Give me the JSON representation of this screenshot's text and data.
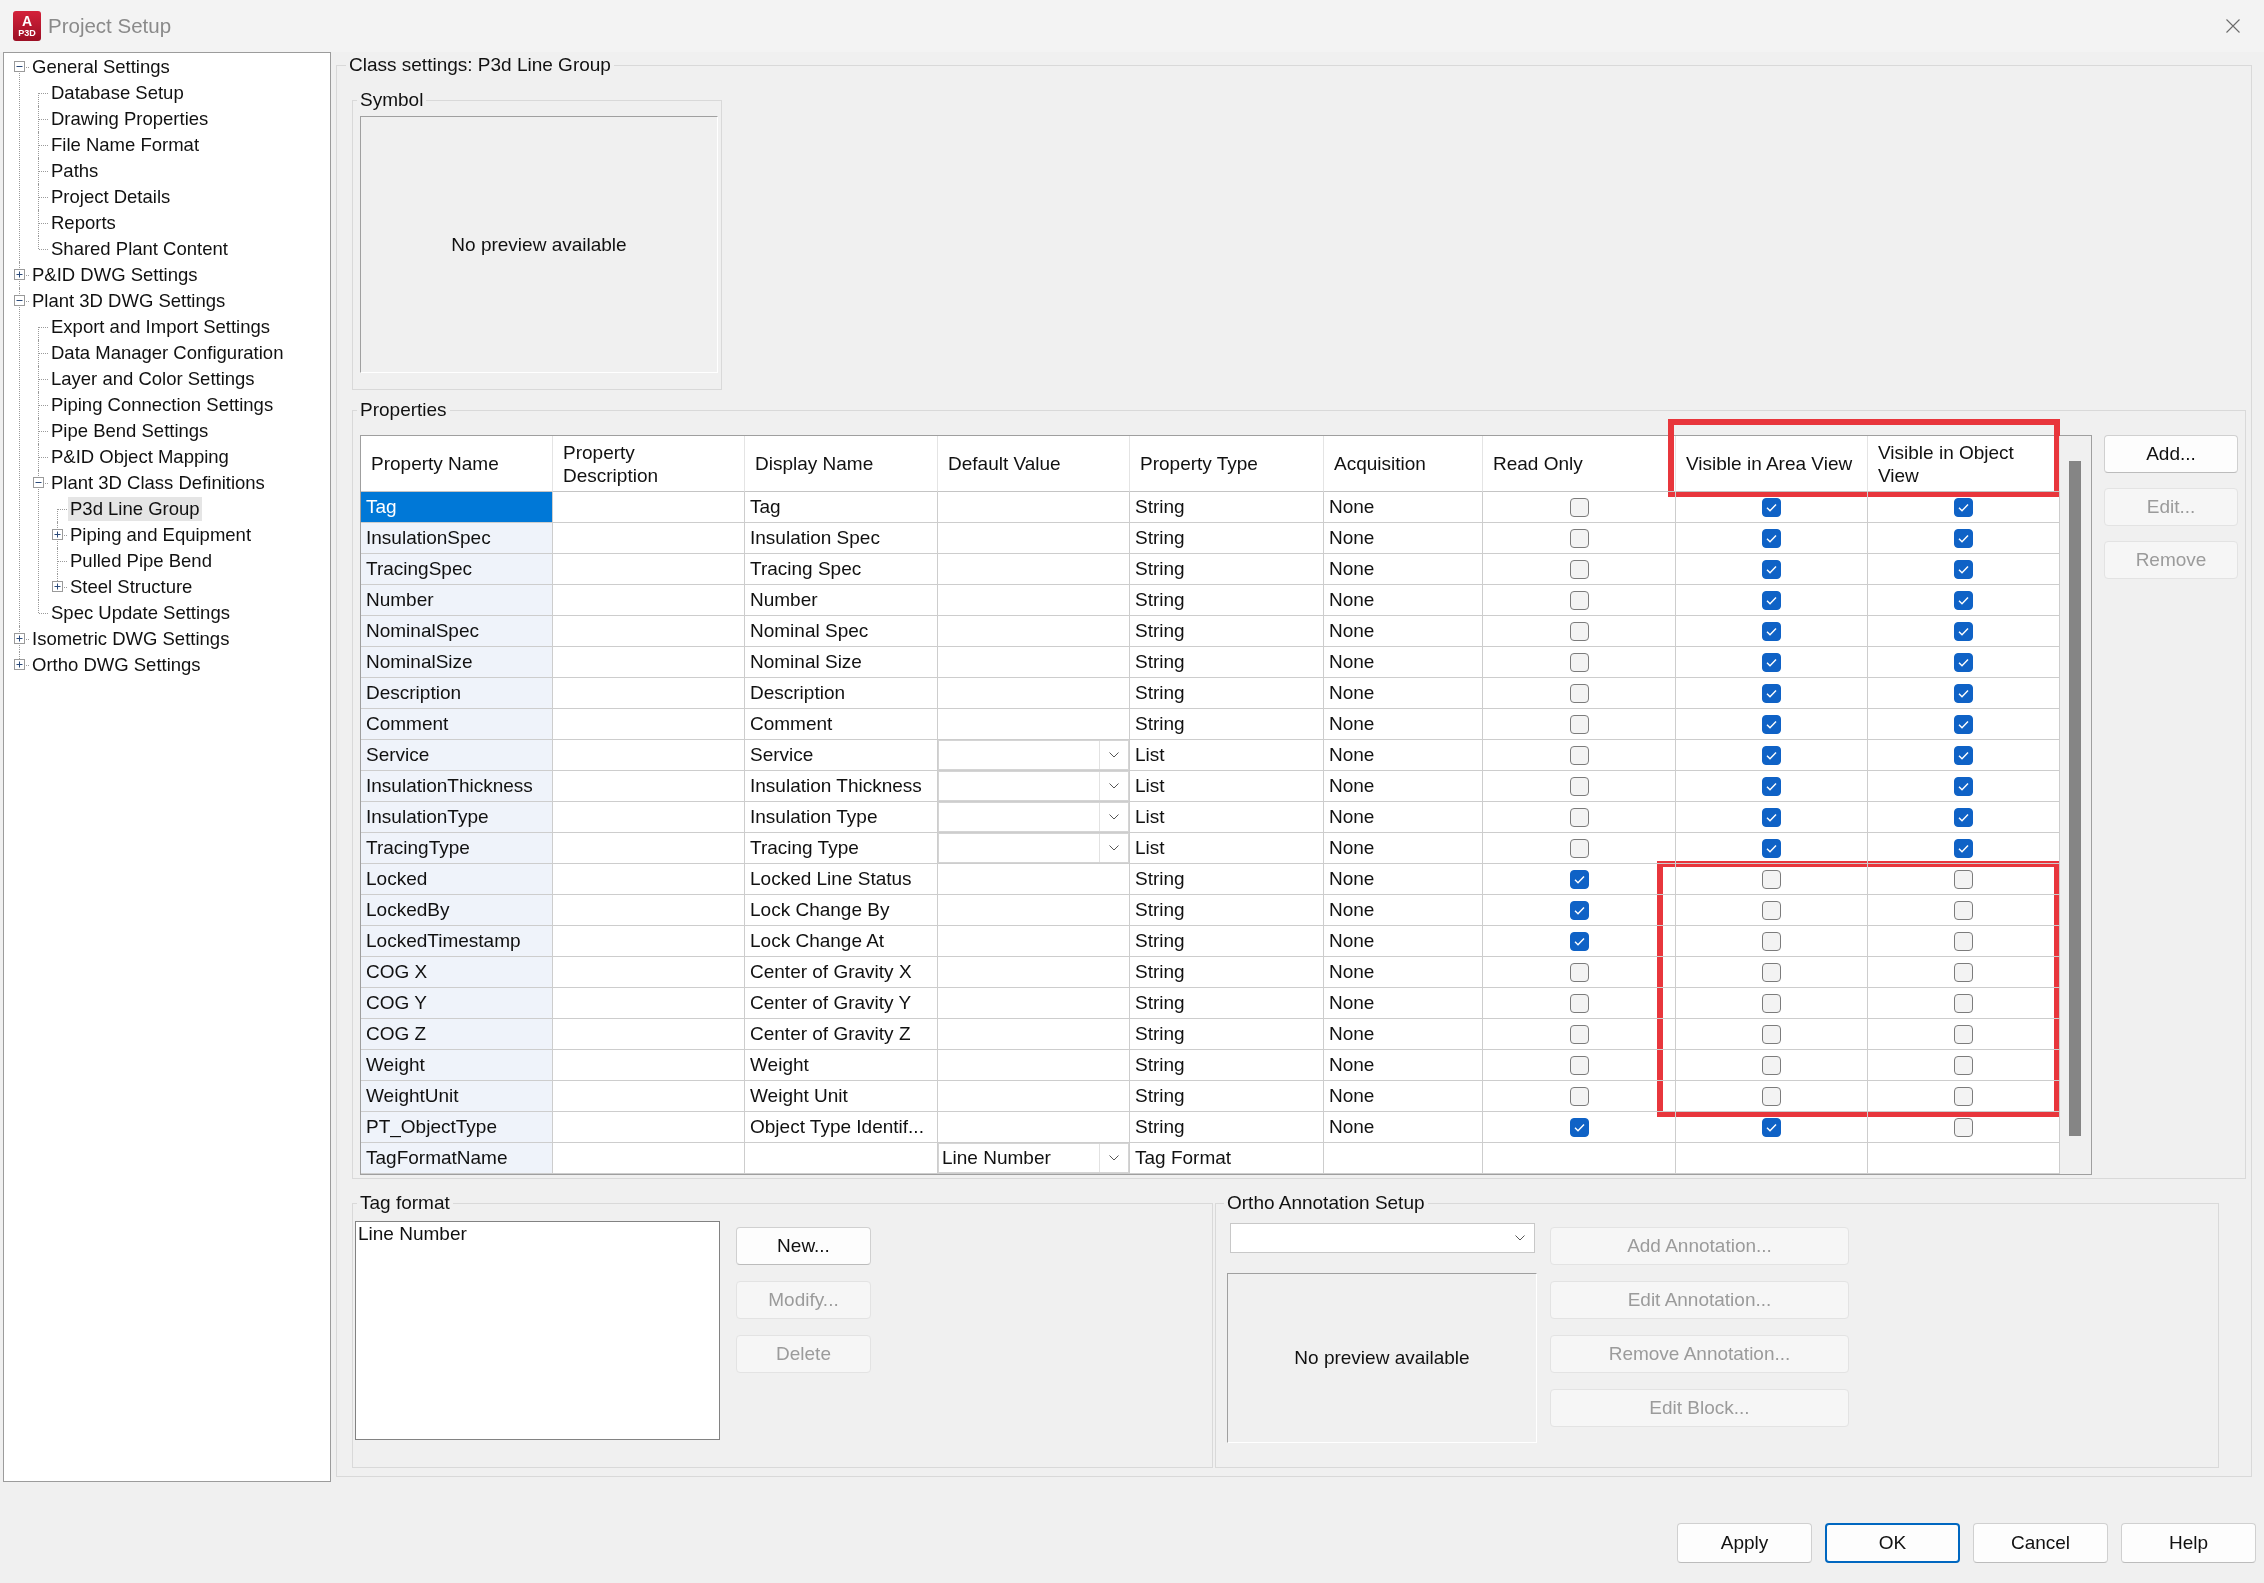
{
  "window": {
    "title": "Project Setup",
    "app_icon": {
      "letter": "A",
      "caption": "P3D"
    }
  },
  "tree": [
    {
      "label": "General Settings",
      "selected": false,
      "expanded": true,
      "children": [
        {
          "label": "Database Setup",
          "selected": false
        },
        {
          "label": "Drawing Properties",
          "selected": false
        },
        {
          "label": "File Name Format",
          "selected": false
        },
        {
          "label": "Paths",
          "selected": false
        },
        {
          "label": "Project Details",
          "selected": false
        },
        {
          "label": "Reports",
          "selected": false
        },
        {
          "label": "Shared Plant Content",
          "selected": false
        }
      ]
    },
    {
      "label": "P&ID DWG Settings",
      "selected": false,
      "expanded": false
    },
    {
      "label": "Plant 3D DWG Settings",
      "selected": false,
      "expanded": true,
      "children": [
        {
          "label": "Export and Import Settings",
          "selected": false
        },
        {
          "label": "Data Manager Configuration",
          "selected": false
        },
        {
          "label": "Layer and Color Settings",
          "selected": false
        },
        {
          "label": "Piping Connection Settings",
          "selected": false
        },
        {
          "label": "Pipe Bend Settings",
          "selected": false
        },
        {
          "label": "P&ID Object Mapping",
          "selected": false
        },
        {
          "label": "Plant 3D Class Definitions",
          "selected": false,
          "expanded": true,
          "children": [
            {
              "label": "P3d Line Group",
              "selected": true
            },
            {
              "label": "Piping and Equipment",
              "selected": false,
              "expanded": false
            },
            {
              "label": "Pulled Pipe Bend",
              "selected": false
            },
            {
              "label": "Steel Structure",
              "selected": false,
              "expanded": false
            }
          ]
        },
        {
          "label": "Spec Update Settings",
          "selected": false
        }
      ]
    },
    {
      "label": "Isometric DWG Settings",
      "selected": false,
      "expanded": false
    },
    {
      "label": "Ortho DWG Settings",
      "selected": false,
      "expanded": false
    }
  ],
  "class_settings": {
    "title": "Class settings: P3d Line Group",
    "symbol": {
      "title": "Symbol",
      "preview_text": "No preview available"
    },
    "properties": {
      "title": "Properties",
      "table": {
        "header_highlighted": true,
        "hidden_rows_highlighted": true,
        "columns": [
          "Property Name",
          "Property Description",
          "Display Name",
          "Default Value",
          "Property Type",
          "Acquisition",
          "Read Only",
          "Visible in Area View",
          "Visible in Object View"
        ],
        "rows": [
          {
            "name": "Tag",
            "display_name": "Tag",
            "type": "String",
            "acquisition": "None",
            "read_only": false,
            "visible_in_area_view": true,
            "visible_in_object_view": true,
            "selected": true
          },
          {
            "name": "InsulationSpec",
            "display_name": "Insulation Spec",
            "type": "String",
            "acquisition": "None",
            "read_only": false,
            "visible_in_area_view": true,
            "visible_in_object_view": true,
            "selected": false
          },
          {
            "name": "TracingSpec",
            "display_name": "Tracing Spec",
            "type": "String",
            "acquisition": "None",
            "read_only": false,
            "visible_in_area_view": true,
            "visible_in_object_view": true,
            "selected": false
          },
          {
            "name": "Number",
            "display_name": "Number",
            "type": "String",
            "acquisition": "None",
            "read_only": false,
            "visible_in_area_view": true,
            "visible_in_object_view": true,
            "selected": false
          },
          {
            "name": "NominalSpec",
            "display_name": "Nominal Spec",
            "type": "String",
            "acquisition": "None",
            "read_only": false,
            "visible_in_area_view": true,
            "visible_in_object_view": true,
            "selected": false
          },
          {
            "name": "NominalSize",
            "display_name": "Nominal Size",
            "type": "String",
            "acquisition": "None",
            "read_only": false,
            "visible_in_area_view": true,
            "visible_in_object_view": true,
            "selected": false
          },
          {
            "name": "Description",
            "display_name": "Description",
            "type": "String",
            "acquisition": "None",
            "read_only": false,
            "visible_in_area_view": true,
            "visible_in_object_view": true,
            "selected": false
          },
          {
            "name": "Comment",
            "display_name": "Comment",
            "type": "String",
            "acquisition": "None",
            "read_only": false,
            "visible_in_area_view": true,
            "visible_in_object_view": true,
            "selected": false
          },
          {
            "name": "Service",
            "display_name": "Service",
            "default_value": {
              "kind": "dropdown"
            },
            "type": "List",
            "acquisition": "None",
            "read_only": false,
            "visible_in_area_view": true,
            "visible_in_object_view": true,
            "selected": false
          },
          {
            "name": "InsulationThickness",
            "display_name": "Insulation Thickness",
            "default_value": {
              "kind": "dropdown"
            },
            "type": "List",
            "acquisition": "None",
            "read_only": false,
            "visible_in_area_view": true,
            "visible_in_object_view": true,
            "selected": false
          },
          {
            "name": "InsulationType",
            "display_name": "Insulation Type",
            "default_value": {
              "kind": "dropdown"
            },
            "type": "List",
            "acquisition": "None",
            "read_only": false,
            "visible_in_area_view": true,
            "visible_in_object_view": true,
            "selected": false
          },
          {
            "name": "TracingType",
            "display_name": "Tracing Type",
            "default_value": {
              "kind": "dropdown"
            },
            "type": "List",
            "acquisition": "None",
            "read_only": false,
            "visible_in_area_view": true,
            "visible_in_object_view": true,
            "selected": false
          },
          {
            "name": "Locked",
            "display_name": "Locked Line Status",
            "type": "String",
            "acquisition": "None",
            "read_only": true,
            "visible_in_area_view": false,
            "visible_in_object_view": false,
            "selected": false
          },
          {
            "name": "LockedBy",
            "display_name": "Lock Change By",
            "type": "String",
            "acquisition": "None",
            "read_only": true,
            "visible_in_area_view": false,
            "visible_in_object_view": false,
            "selected": false
          },
          {
            "name": "LockedTimestamp",
            "display_name": "Lock Change At",
            "type": "String",
            "acquisition": "None",
            "read_only": true,
            "visible_in_area_view": false,
            "visible_in_object_view": false,
            "selected": false
          },
          {
            "name": "COG X",
            "display_name": "Center of Gravity X",
            "type": "String",
            "acquisition": "None",
            "read_only": false,
            "visible_in_area_view": false,
            "visible_in_object_view": false,
            "selected": false
          },
          {
            "name": "COG Y",
            "display_name": "Center of Gravity Y",
            "type": "String",
            "acquisition": "None",
            "read_only": false,
            "visible_in_area_view": false,
            "visible_in_object_view": false,
            "selected": false
          },
          {
            "name": "COG Z",
            "display_name": "Center of Gravity Z",
            "type": "String",
            "acquisition": "None",
            "read_only": false,
            "visible_in_area_view": false,
            "visible_in_object_view": false,
            "selected": false
          },
          {
            "name": "Weight",
            "display_name": "Weight",
            "type": "String",
            "acquisition": "None",
            "read_only": false,
            "visible_in_area_view": false,
            "visible_in_object_view": false,
            "selected": false
          },
          {
            "name": "WeightUnit",
            "display_name": "Weight Unit",
            "type": "String",
            "acquisition": "None",
            "read_only": false,
            "visible_in_area_view": false,
            "visible_in_object_view": false,
            "selected": false
          },
          {
            "name": "PT_ObjectType",
            "display_name": "Object Type Identif...",
            "type": "String",
            "acquisition": "None",
            "read_only": true,
            "visible_in_area_view": true,
            "visible_in_object_view": false,
            "selected": false
          },
          {
            "name": "TagFormatName",
            "default_value": {
              "kind": "dropdown",
              "value": "Line Number"
            },
            "type": "Tag Format",
            "selected": false
          }
        ]
      },
      "buttons": [
        {
          "label": "Add...",
          "disabled": false
        },
        {
          "label": "Edit...",
          "disabled": true
        },
        {
          "label": "Remove",
          "disabled": true
        }
      ]
    },
    "tag_format": {
      "title": "Tag format",
      "items": [
        {
          "label": "Line Number",
          "selected": false
        }
      ],
      "buttons": [
        {
          "label": "New...",
          "disabled": false
        },
        {
          "label": "Modify...",
          "disabled": true
        },
        {
          "label": "Delete",
          "disabled": true
        }
      ]
    },
    "ortho_annotation_setup": {
      "title": "Ortho Annotation Setup",
      "preview_text": "No preview available",
      "buttons": [
        {
          "label": "Add Annotation...",
          "disabled": true
        },
        {
          "label": "Edit Annotation...",
          "disabled": true
        },
        {
          "label": "Remove Annotation...",
          "disabled": true
        },
        {
          "label": "Edit Block...",
          "disabled": true
        }
      ]
    }
  },
  "dialog_buttons": [
    {
      "label": "Apply",
      "default": false
    },
    {
      "label": "OK",
      "default": true
    },
    {
      "label": "Cancel",
      "default": false
    },
    {
      "label": "Help",
      "default": false
    }
  ]
}
